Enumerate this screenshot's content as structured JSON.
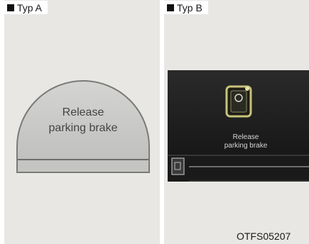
{
  "panels": [
    {
      "label": "Typ A",
      "message_line1": "Release",
      "message_line2": "parking brake"
    },
    {
      "label": "Typ B",
      "message_line1": "Release",
      "message_line2": "parking brake"
    }
  ],
  "figure_code": "OTFS05207",
  "icons": {
    "panel_b_warning": "parking-brake-warning-icon",
    "panel_b_corner": "corner-icon"
  },
  "colors": {
    "dome_fill": "#c8c8c6",
    "display_bg": "#1c1c1c",
    "warning_outline": "#c9c37a"
  }
}
